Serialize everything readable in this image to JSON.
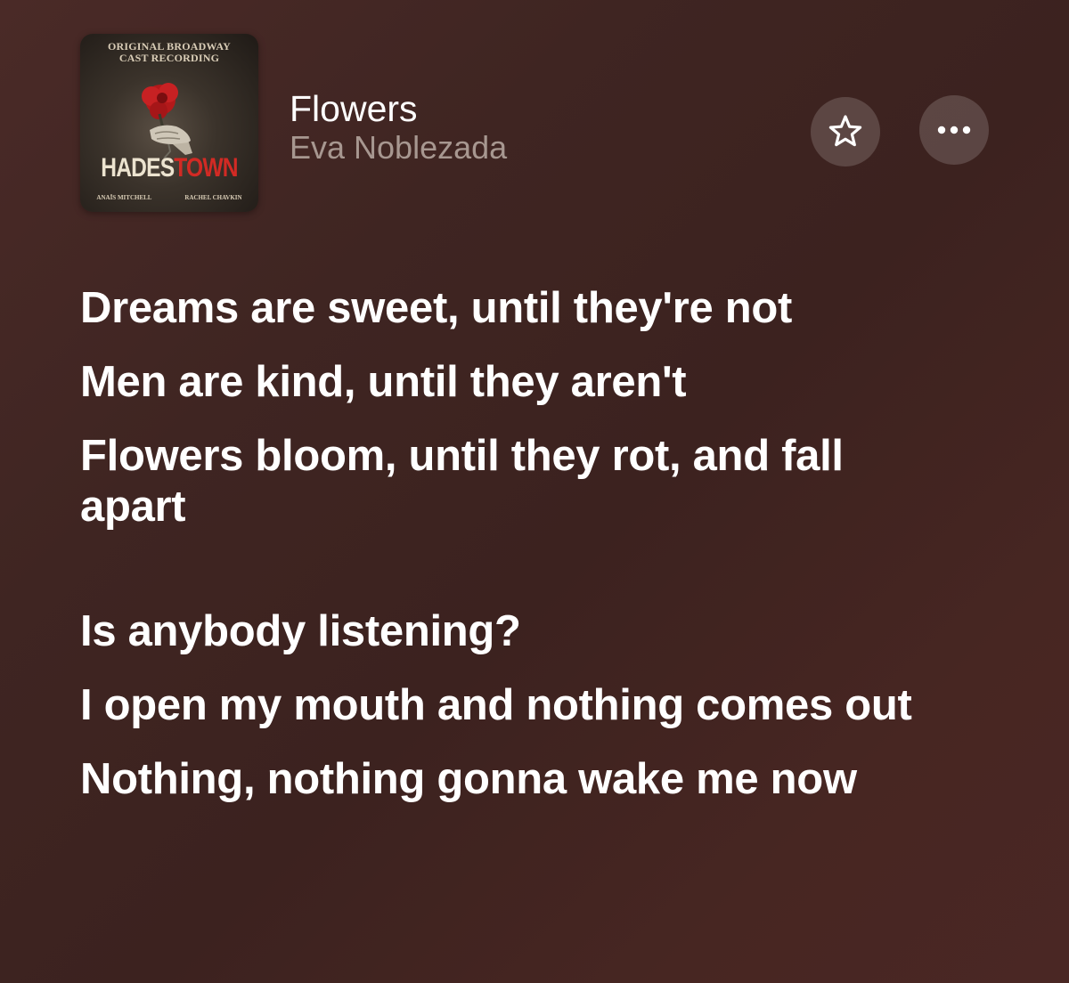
{
  "album": {
    "art_top_line1": "ORIGINAL BROADWAY",
    "art_top_line2": "CAST RECORDING",
    "art_title_part1": "HADES",
    "art_title_part2": "TOWN",
    "art_credit_left": "ANAÏS MITCHELL",
    "art_credit_right": "RACHEL CHAVKIN"
  },
  "song": {
    "title": "Flowers",
    "artist": "Eva Noblezada"
  },
  "actions": {
    "favorite_icon": "star-icon",
    "more_icon": "ellipsis-icon"
  },
  "lyrics": {
    "stanza1": [
      "Dreams are sweet, until they're not",
      "Men are kind, until they aren't",
      "Flowers bloom, until they rot, and fall apart"
    ],
    "stanza2": [
      "Is anybody listening?",
      "I open my mouth and nothing comes out",
      "Nothing, nothing gonna wake me now"
    ]
  },
  "colors": {
    "background": "#3f2522",
    "title_text": "#ffffff",
    "artist_text": "#a79790",
    "button_fill": "rgba(255,255,255,0.16)",
    "hades_red": "#d22a24"
  }
}
